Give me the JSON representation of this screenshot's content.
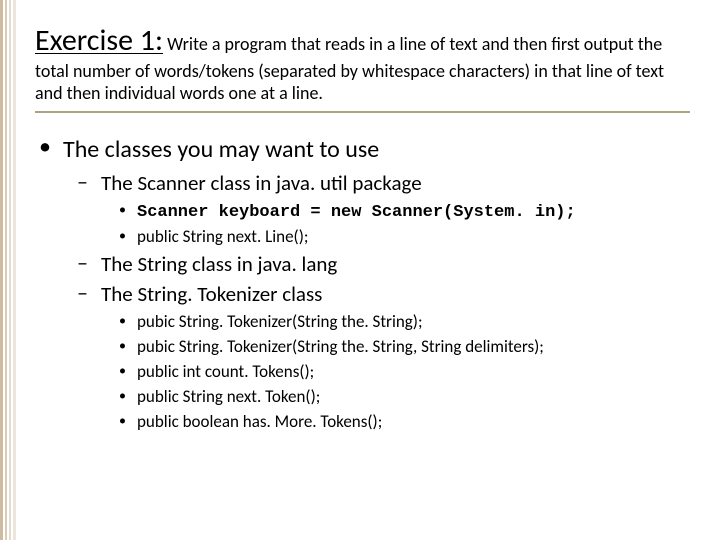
{
  "title_strong": "Exercise 1:",
  "title_rest": " Write a program that reads in a line of text and then first output the total number of words/tokens (separated by whitespace characters) in that line of text and then individual words one at a line.",
  "bullet_main": "The classes you may want to use",
  "sub": {
    "scanner": "The Scanner class in java. util package",
    "scanner_code": "Scanner keyboard = new Scanner(System. in);",
    "scanner_next": "public String next. Line();",
    "string_lang": "The String class in java. lang",
    "tokenizer": "The String. Tokenizer class",
    "t1": "pubic String. Tokenizer(String the. String);",
    "t2": "pubic String. Tokenizer(String the. String, String delimiters);",
    "t3": "public int count. Tokens();",
    "t4": "public String next. Token();",
    "t5": "public boolean has. More. Tokens();"
  }
}
